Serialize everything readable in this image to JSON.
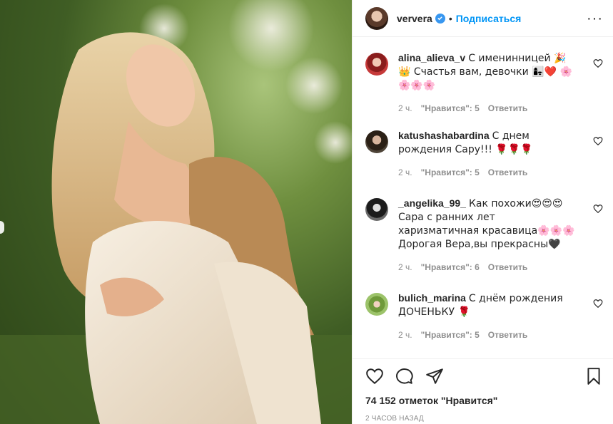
{
  "post": {
    "username": "ververa",
    "follow_label": "Подписаться",
    "dot": "•",
    "more": "···"
  },
  "comments": [
    {
      "user": "alina_alieva_v",
      "text": "С именинницей 🎉👑 Счастья вам, девочки 👩‍👧❤️ 🌸🌸🌸🌸",
      "time": "2 ч.",
      "likes": "\"Нравится\": 5",
      "reply": "Ответить"
    },
    {
      "user": "katushashabardina",
      "text": "С днем рождения Сару!!! 🌹🌹🌹",
      "time": "2 ч.",
      "likes": "\"Нравится\": 5",
      "reply": "Ответить"
    },
    {
      "user": "_angelika_99_",
      "text": "Как похожи😍😍😍Сара с ранних лет харизматичная красавица🌸🌸🌸 Дорогая Вера,вы прекрасны🖤",
      "time": "2 ч.",
      "likes": "\"Нравится\": 6",
      "reply": "Ответить"
    },
    {
      "user": "bulich_marina",
      "text": "С днём рождения ДОЧЕНЬКУ 🌹",
      "time": "2 ч.",
      "likes": "\"Нравится\": 5",
      "reply": "Ответить"
    }
  ],
  "footer": {
    "likes": "74 152 отметок \"Нравится\"",
    "time": "2 ЧАСОВ НАЗАД"
  },
  "icons": [
    "heart-icon",
    "comment-icon",
    "share-icon",
    "bookmark-icon",
    "verified-icon"
  ],
  "colors": {
    "accent": "#0095f6",
    "verified": "#3897f0",
    "muted": "#8e8e8e"
  }
}
